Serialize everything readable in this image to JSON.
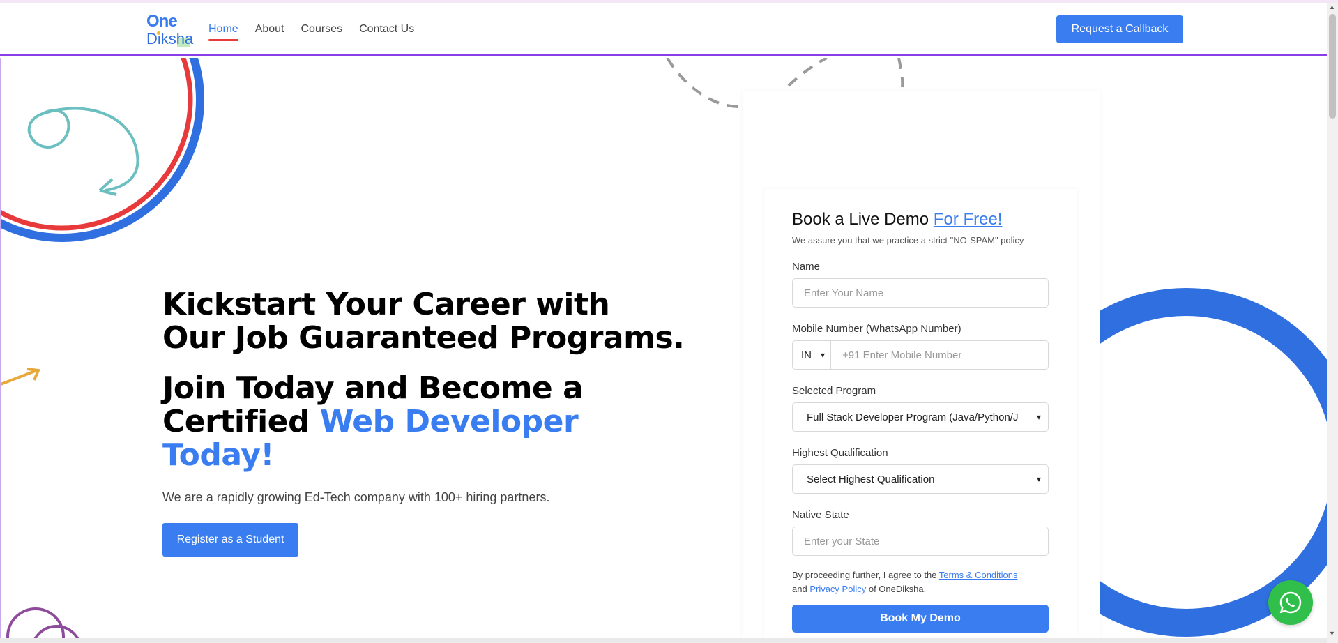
{
  "header": {
    "logo_top": "One",
    "logo_bottom": "Diksha",
    "nav": [
      {
        "label": "Home",
        "active": true
      },
      {
        "label": "About",
        "active": false
      },
      {
        "label": "Courses",
        "active": false
      },
      {
        "label": "Contact Us",
        "active": false
      }
    ],
    "callback_label": "Request a Callback"
  },
  "hero": {
    "line1": "Kickstart Your Career with",
    "line2": "Our Job Guaranteed Programs.",
    "join_line1": "Join Today and Become a",
    "join_certified": "Certified ",
    "join_highlight": "Web Developer",
    "join_today": "Today!",
    "description": "We are a rapidly growing Ed-Tech company with 100+ hiring partners.",
    "register_label": "Register as a Student"
  },
  "form": {
    "title": "Book a Live Demo ",
    "title_link": "For Free!",
    "subtitle": "We assure you that we practice a strict \"NO-SPAM\" policy",
    "name_label": "Name",
    "name_placeholder": "Enter Your Name",
    "mobile_label": "Mobile Number (WhatsApp Number)",
    "country_code": "IN",
    "mobile_placeholder": "+91 Enter Mobile Number",
    "program_label": "Selected Program",
    "program_value": "Full Stack Developer Program (Java/Python/J",
    "qualification_label": "Highest Qualification",
    "qualification_value": "Select Highest Qualification",
    "state_label": "Native State",
    "state_placeholder": "Enter your State",
    "terms_prefix": "By proceeding further, I agree to the ",
    "terms_link": "Terms & Conditions",
    "terms_and": "and ",
    "privacy_link": "Privacy Policy",
    "terms_suffix": " of OneDiksha.",
    "submit_label": "Book My Demo"
  },
  "colors": {
    "accent": "#3a7df0",
    "red": "#e83a3a",
    "purple_border": "#8a3ee8",
    "whatsapp": "#2fbf4a"
  },
  "icons": [
    "chevron-down-icon",
    "whatsapp-icon"
  ]
}
